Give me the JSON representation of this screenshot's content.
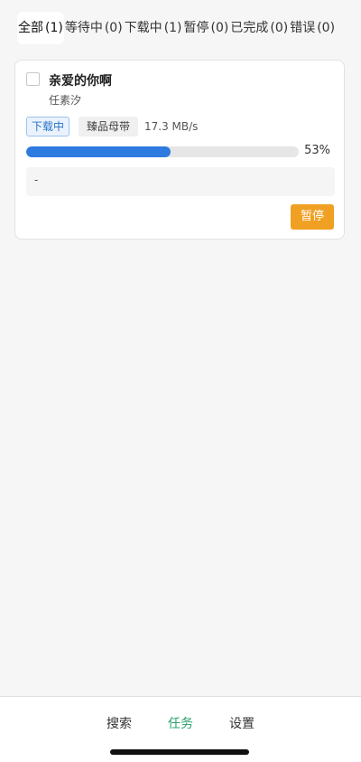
{
  "filter_tabs": [
    {
      "label": "全部",
      "count": "(1)"
    },
    {
      "label": "等待中",
      "count": "(0)"
    },
    {
      "label": "下载中",
      "count": "(1)"
    },
    {
      "label": "暂停",
      "count": "(0)"
    },
    {
      "label": "已完成",
      "count": "(0)"
    },
    {
      "label": "错误",
      "count": "(0)"
    }
  ],
  "active_filter": "全部",
  "task": {
    "title": "亲爱的你啊",
    "artist": "任素汐",
    "status": "下载中",
    "quality": "臻品母带",
    "speed": "17.3 MB/s",
    "progress": 0.53,
    "percent_text": "53%",
    "message": "-",
    "action_label": "暂停",
    "selected": false
  },
  "bottom_nav": {
    "items": [
      {
        "label": "搜索",
        "active": false
      },
      {
        "label": "任务",
        "active": true
      },
      {
        "label": "设置",
        "active": false
      }
    ]
  },
  "colors": {
    "accent_green": "#2aa06a",
    "progress_blue": "#2e7be0",
    "pause_orange": "#f0a023",
    "status_blue": "#2a73c8"
  }
}
